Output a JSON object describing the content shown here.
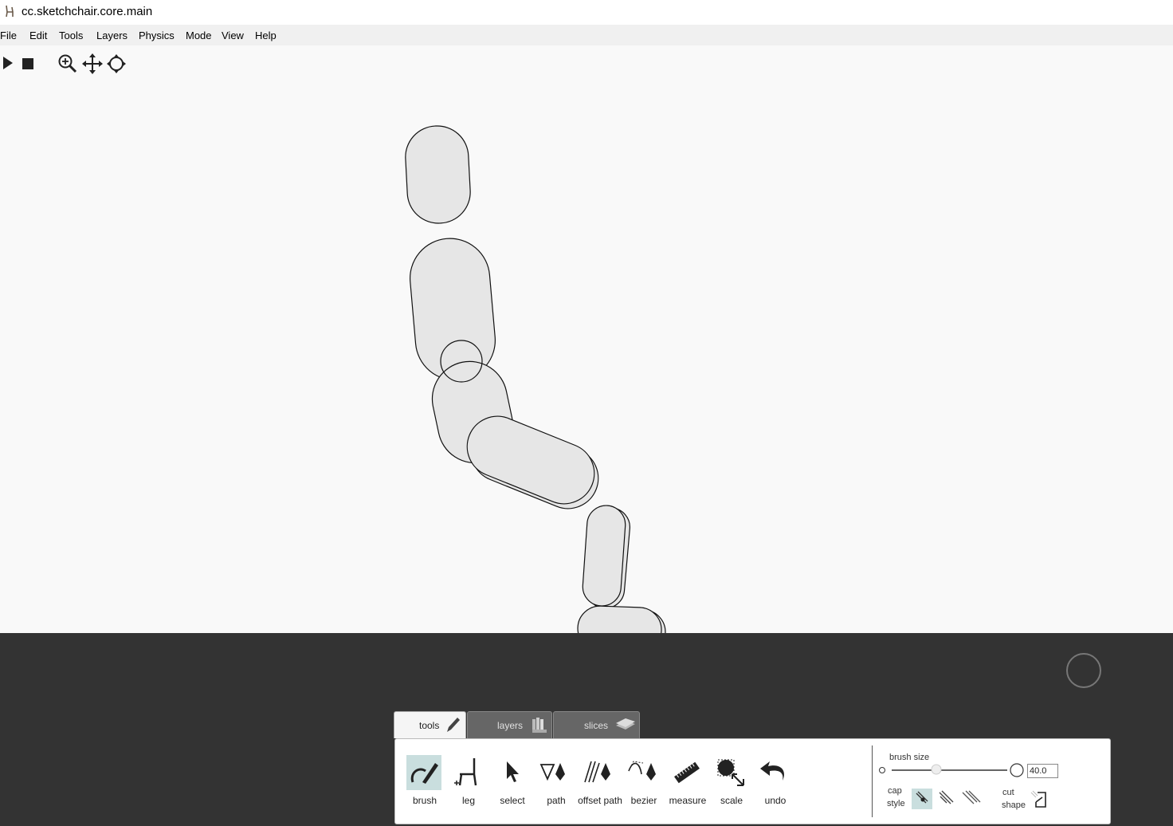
{
  "window": {
    "title": "cc.sketchchair.core.main"
  },
  "menu": [
    "File",
    "Edit",
    "Tools",
    "Layers",
    "Physics",
    "Mode",
    "View",
    "Help"
  ],
  "toolbar": {
    "icons": [
      "play-icon",
      "stop-icon",
      "zoom-icon",
      "pan-icon",
      "rotate-icon"
    ]
  },
  "tabs": [
    {
      "label": "tools",
      "active": true
    },
    {
      "label": "layers",
      "active": false
    },
    {
      "label": "slices",
      "active": false
    }
  ],
  "tools": [
    {
      "label": "brush",
      "icon": "brush-icon",
      "selected": true
    },
    {
      "label": "leg",
      "icon": "leg-icon",
      "selected": false
    },
    {
      "label": "select",
      "icon": "select-cursor-icon",
      "selected": false
    },
    {
      "label": "path",
      "icon": "path-pen-icon",
      "selected": false
    },
    {
      "label": "offset path",
      "icon": "offset-path-icon",
      "selected": false
    },
    {
      "label": "bezier",
      "icon": "bezier-icon",
      "selected": false
    },
    {
      "label": "measure",
      "icon": "ruler-icon",
      "selected": false
    },
    {
      "label": "scale",
      "icon": "scale-icon",
      "selected": false
    },
    {
      "label": "undo",
      "icon": "undo-icon",
      "selected": false
    }
  ],
  "settings": {
    "brush_size_label": "brush size",
    "brush_size_value": "40.0",
    "cap_label_1": "cap",
    "cap_label_2": "style",
    "cut_label_1": "cut",
    "cut_label_2": "shape"
  },
  "colors": {
    "dark_panel": "#333333",
    "selected_tool": "#c9dede",
    "canvas": "#f9f9f9"
  }
}
